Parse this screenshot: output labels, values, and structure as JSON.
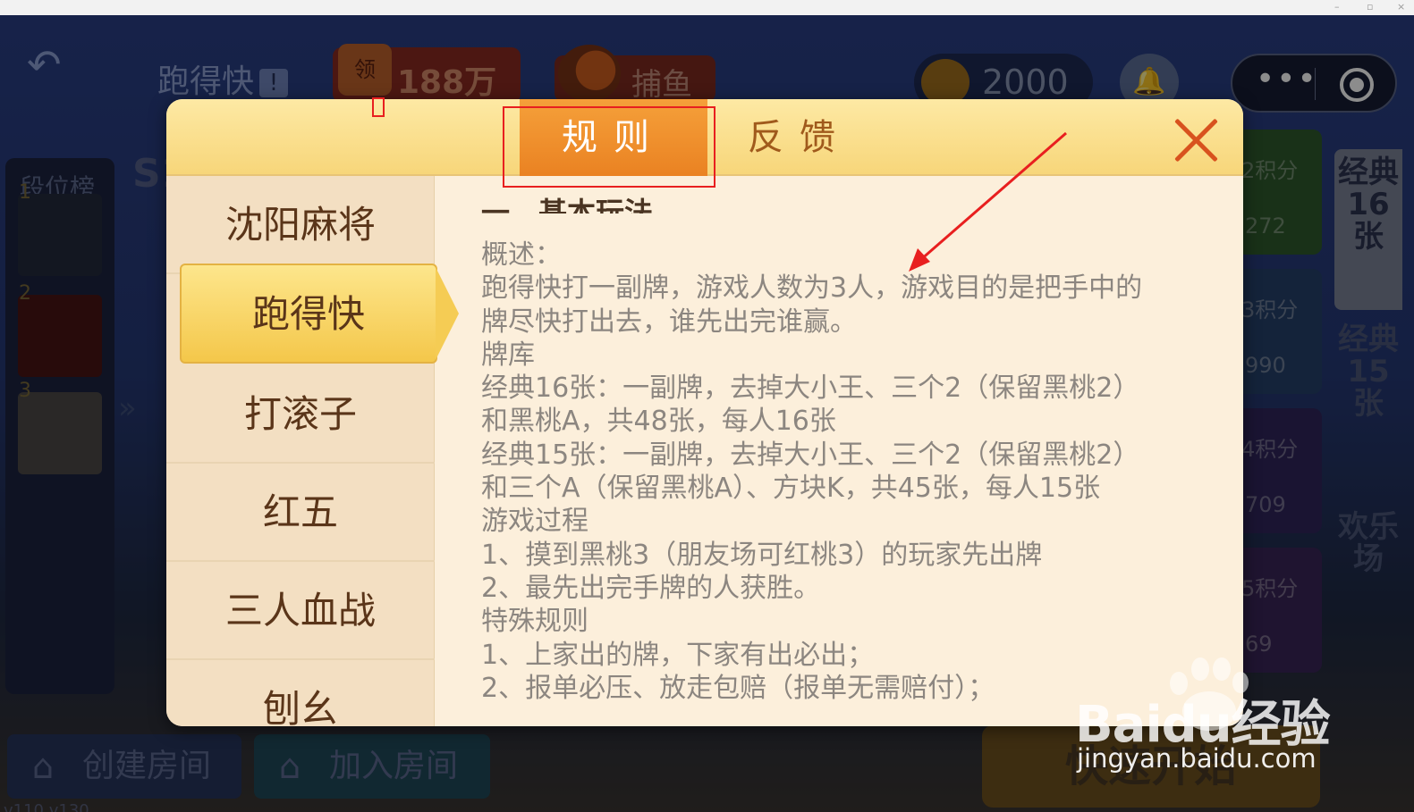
{
  "top_bar": {
    "game_title": "跑得快",
    "info_glyph": "!",
    "promo_badge": "领",
    "promo_beans": "188万豆",
    "fish_label": "捕鱼",
    "coin_balance": "2000"
  },
  "rank": {
    "title": "段位榜",
    "season_mark": "S1",
    "positions": [
      "1",
      "2",
      "3"
    ]
  },
  "side_tabs": [
    "经典16张",
    "经典15张",
    "欢乐场"
  ],
  "score_cards": [
    {
      "label": "2积分",
      "value": "272",
      "color": "#3f8a3c"
    },
    {
      "label": "3积分",
      "value": "990",
      "color": "#3a5d9e"
    },
    {
      "label": "4积分",
      "value": "709",
      "color": "#4d3b8c"
    },
    {
      "label": "5积分",
      "value": "69",
      "color": "#5a3a86"
    }
  ],
  "bottom": {
    "create_room": "创建房间",
    "join_room": "加入房间",
    "quick_start": "快速开始",
    "version": "v110 v130"
  },
  "dialog": {
    "tabs": {
      "rules": "规则",
      "feedback": "反馈"
    },
    "games": [
      "沈阳麻将",
      "跑得快",
      "打滚子",
      "红五",
      "三人血战",
      "刨幺"
    ],
    "active_game": "跑得快",
    "section_title": "一、基本玩法",
    "lines": [
      "概述：",
      "跑得快打一副牌，游戏人数为3人，游戏目的是把手中的",
      "牌尽快打出去，谁先出完谁赢。",
      "牌库",
      "经典16张：一副牌，去掉大小王、三个2（保留黑桃2）",
      "和黑桃A，共48张，每人16张",
      "经典15张：一副牌，去掉大小王、三个2（保留黑桃2）",
      "和三个A（保留黑桃A）、方块K，共45张，每人15张",
      "游戏过程",
      "1、摸到黑桃3（朋友场可红桃3）的玩家先出牌",
      "2、最先出完手牌的人获胜。",
      "特殊规则",
      "1、上家出的牌，下家有出必出；",
      "2、报单必压、放走包赔（报单无需赔付）；"
    ]
  },
  "watermark": {
    "brand": "Baidu经验",
    "url": "jingyan.baidu.com"
  },
  "colors": {
    "accent_orange": "#ea8222",
    "annotation_red": "#e81f1f",
    "dialog_bg": "#fcefdb",
    "active_item": "#f4c74a"
  }
}
